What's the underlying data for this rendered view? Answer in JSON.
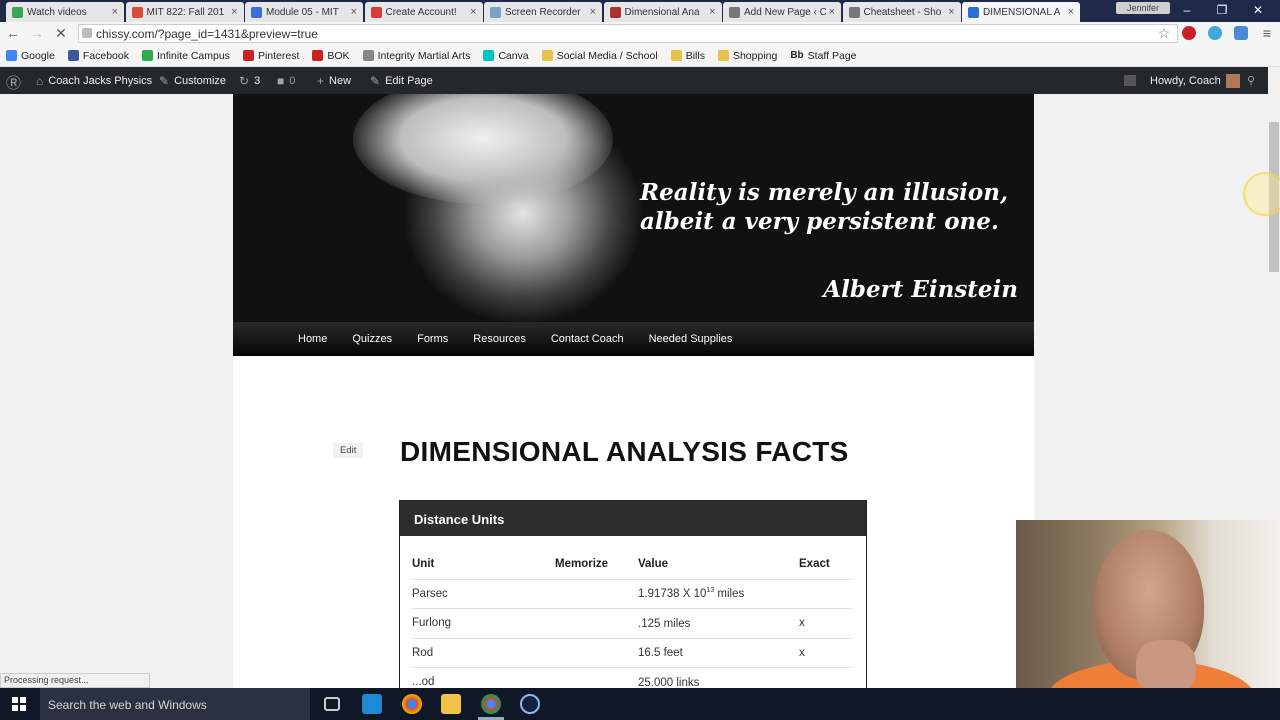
{
  "browser": {
    "tabs": [
      {
        "label": "Watch videos",
        "color": "#3aa757"
      },
      {
        "label": "MIT 822: Fall 201",
        "color": "#d94b3b"
      },
      {
        "label": "Module 05 - MIT",
        "color": "#3b6fd9"
      },
      {
        "label": "Create Account!",
        "color": "#d93b3b"
      },
      {
        "label": "Screen Recorder",
        "color": "#7aa0c8"
      },
      {
        "label": "Dimensional Ana",
        "color": "#a83232"
      },
      {
        "label": "Add New Page ‹ C",
        "color": "#777777"
      },
      {
        "label": "Cheatsheet - Sho",
        "color": "#777777"
      },
      {
        "label": "DIMENSIONAL A",
        "color": "#2a6fd9"
      }
    ],
    "profile": "Jennifer",
    "url": "chissy.com/?page_id=1431&preview=true",
    "bookmarks": [
      {
        "label": "Google",
        "color": "#4285f4"
      },
      {
        "label": "Facebook",
        "color": "#3b5998"
      },
      {
        "label": "Infinite Campus",
        "color": "#2fa94e"
      },
      {
        "label": "Pinterest",
        "color": "#cb2027"
      },
      {
        "label": "BOK",
        "color": "#cc2222"
      },
      {
        "label": "Integrity Martial Arts",
        "color": "#888888"
      },
      {
        "label": "Canva",
        "color": "#00c4cc"
      },
      {
        "label": "Social Media / School",
        "color": "#e8c14a"
      },
      {
        "label": "Bills",
        "color": "#e8c14a"
      },
      {
        "label": "Shopping",
        "color": "#e8c14a"
      },
      {
        "label": "Staff Page",
        "color": "#333333",
        "prefix": "Bb"
      }
    ],
    "status": "Processing request..."
  },
  "adminbar": {
    "site": "Coach Jacks Physics",
    "customize": "Customize",
    "updates": "3",
    "comments": "0",
    "new": "New",
    "edit_page": "Edit Page",
    "howdy": "Howdy, Coach"
  },
  "header": {
    "quote_line1": "Reality is merely an illusion,",
    "quote_line2": "albeit a very persistent one.",
    "attribution": "Albert Einstein"
  },
  "nav": [
    "Home",
    "Quizzes",
    "Forms",
    "Resources",
    "Contact Coach",
    "Needed Supplies"
  ],
  "content": {
    "edit_label": "Edit",
    "title": "DIMENSIONAL ANALYSIS FACTS",
    "box_title": "Distance Units",
    "columns": [
      "Unit",
      "Memorize",
      "Value",
      "Exact"
    ],
    "rows": [
      {
        "unit": "Parsec",
        "memorize": "",
        "value": "1.91738 X 10",
        "sup": "13",
        "value_suffix": " miles",
        "exact": ""
      },
      {
        "unit": "Furlong",
        "memorize": "",
        "value": ".125 miles",
        "sup": "",
        "value_suffix": "",
        "exact": "x"
      },
      {
        "unit": "Rod",
        "memorize": "",
        "value": "16.5 feet",
        "sup": "",
        "value_suffix": "",
        "exact": "x"
      },
      {
        "unit": "...od",
        "memorize": "",
        "value": "25.000 links",
        "sup": "",
        "value_suffix": "",
        "exact": ""
      }
    ]
  },
  "taskbar": {
    "search_placeholder": "Search the web and Windows"
  }
}
